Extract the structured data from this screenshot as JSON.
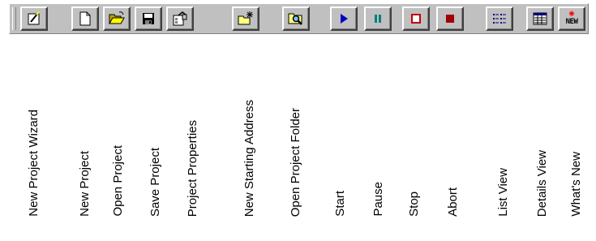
{
  "toolbar": {
    "buttons": [
      {
        "id": "new-project-wizard",
        "label": "New Project Wizard",
        "icon": "wand-note-icon"
      },
      {
        "id": "new-project",
        "label": "New Project",
        "icon": "blank-page-icon"
      },
      {
        "id": "open-project",
        "label": "Open Project",
        "icon": "open-folder-icon"
      },
      {
        "id": "save-project",
        "label": "Save Project",
        "icon": "floppy-disk-icon"
      },
      {
        "id": "project-properties",
        "label": "Project Properties",
        "icon": "properties-icon"
      },
      {
        "id": "new-starting-address",
        "label": "New Starting Address",
        "icon": "folder-sparkle-icon"
      },
      {
        "id": "open-project-folder",
        "label": "Open Project Folder",
        "icon": "folder-magnifier-icon"
      },
      {
        "id": "start",
        "label": "Start",
        "icon": "play-icon"
      },
      {
        "id": "pause",
        "label": "Pause",
        "icon": "pause-icon"
      },
      {
        "id": "stop",
        "label": "Stop",
        "icon": "stop-icon"
      },
      {
        "id": "abort",
        "label": "Abort",
        "icon": "abort-icon"
      },
      {
        "id": "list-view",
        "label": "List View",
        "icon": "list-view-icon"
      },
      {
        "id": "details-view",
        "label": "Details View",
        "icon": "details-view-icon"
      },
      {
        "id": "whats-new",
        "label": "What's New",
        "icon": "new-badge-icon",
        "icon_text": "NEW"
      }
    ]
  }
}
